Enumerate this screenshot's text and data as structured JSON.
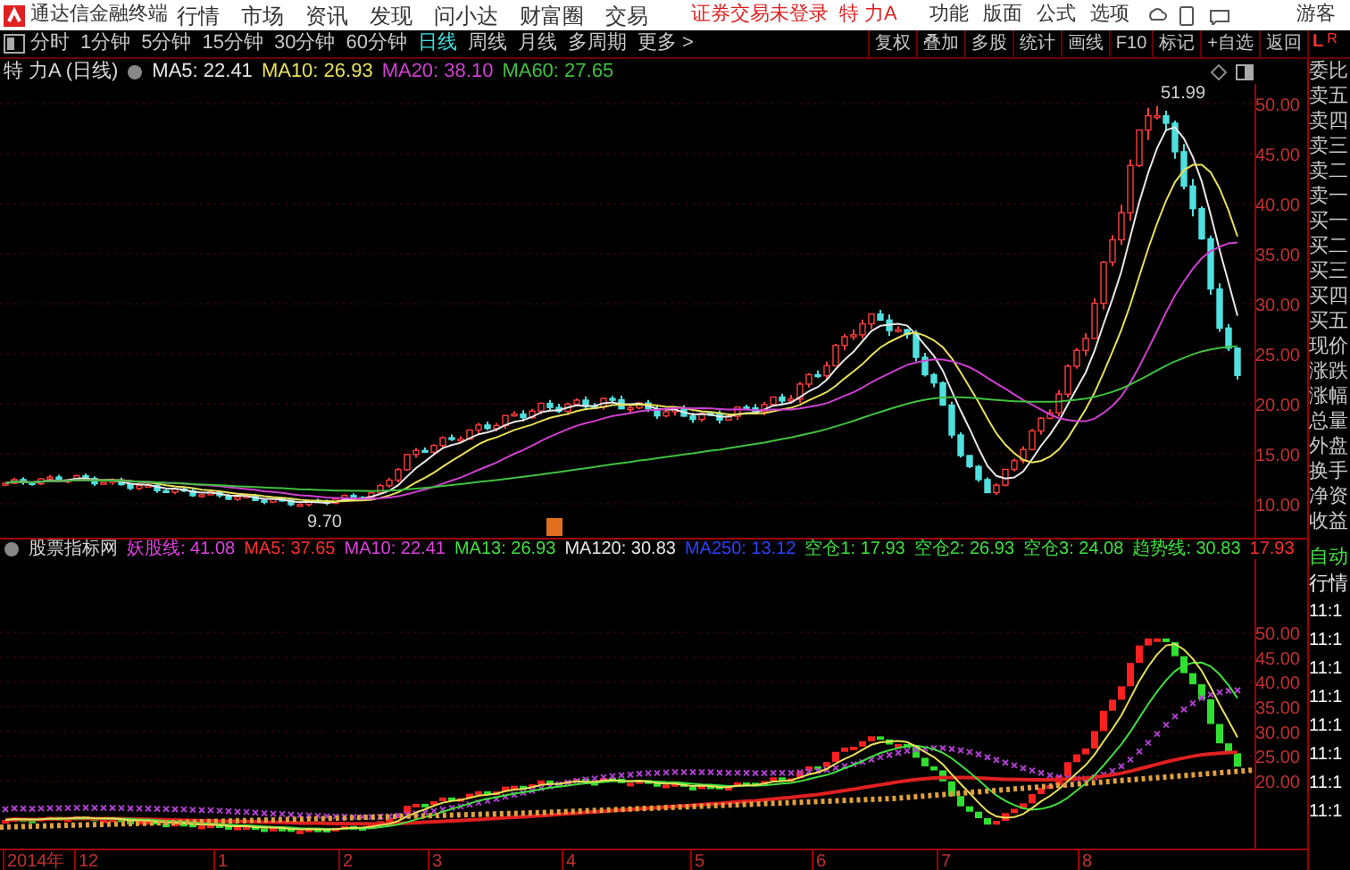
{
  "menu_bar": {
    "app_title": "通达信金融终端",
    "items": [
      "行情",
      "市场",
      "资讯",
      "发现",
      "问小达",
      "财富圈",
      "交易"
    ],
    "login_notice": "证券交易未登录",
    "stock_name": "特 力A",
    "right_items": [
      "功能",
      "版面",
      "公式",
      "选项"
    ],
    "user": "游客"
  },
  "period_tabs": [
    {
      "label": "分时",
      "selected": false
    },
    {
      "label": "1分钟",
      "selected": false
    },
    {
      "label": "5分钟",
      "selected": false
    },
    {
      "label": "15分钟",
      "selected": false
    },
    {
      "label": "30分钟",
      "selected": false
    },
    {
      "label": "60分钟",
      "selected": false
    },
    {
      "label": "日线",
      "selected": true
    },
    {
      "label": "周线",
      "selected": false
    },
    {
      "label": "月线",
      "selected": false
    },
    {
      "label": "多周期",
      "selected": false
    },
    {
      "label": "更多 >",
      "selected": false
    }
  ],
  "tool_buttons": [
    "复权",
    "叠加",
    "多股",
    "统计",
    "画线",
    "F10",
    "标记",
    "+自选",
    "返回"
  ],
  "panel_tabs": [
    "L",
    "R"
  ],
  "price_chart": {
    "title": "特 力A (日线)",
    "legend": [
      {
        "label": "MA5: 22.41",
        "color": "#e8e8e8"
      },
      {
        "label": "MA10: 26.93",
        "color": "#e8e05a"
      },
      {
        "label": "MA20: 38.10",
        "color": "#d040d0"
      },
      {
        "label": "MA60: 27.65",
        "color": "#40c040"
      }
    ],
    "y_ticks": [
      "50.00",
      "45.00",
      "40.00",
      "35.00",
      "30.00",
      "25.00",
      "20.00",
      "15.00",
      "10.00"
    ],
    "high_label": "51.99",
    "low_label": "9.70"
  },
  "indicator_chart": {
    "title": "股票指标网",
    "legend": [
      {
        "label": "妖股线: 41.08",
        "color": "#e040e0"
      },
      {
        "label": "MA5: 37.65",
        "color": "#ff3030"
      },
      {
        "label": "MA10: 22.41",
        "color": "#e040e0"
      },
      {
        "label": "MA13: 26.93",
        "color": "#40e040"
      },
      {
        "label": "MA120: 30.83",
        "color": "#e8e8e8"
      },
      {
        "label": "MA250: 13.12",
        "color": "#3040ff"
      },
      {
        "label": "空仓1: 17.93",
        "color": "#40e040"
      },
      {
        "label": "空仓2: 26.93",
        "color": "#40e040"
      },
      {
        "label": "空仓3: 24.08",
        "color": "#40e040"
      },
      {
        "label": "趋势线: 30.83",
        "color": "#40e040"
      },
      {
        "label": "17.93",
        "color": "#ff3030"
      }
    ],
    "y_ticks": [
      "50.00",
      "45.00",
      "40.00",
      "35.00",
      "30.00",
      "25.00",
      "20.00"
    ]
  },
  "x_axis": [
    "2014年",
    "12",
    "1",
    "2",
    "3",
    "4",
    "5",
    "6",
    "7",
    "8"
  ],
  "quote_panel": {
    "labels": [
      "委比",
      "卖五",
      "卖四",
      "卖三",
      "卖二",
      "卖一",
      "买一",
      "买二",
      "买三",
      "买四",
      "买五",
      "现价",
      "涨跌",
      "涨幅",
      "总量",
      "外盘",
      "换手",
      "净资",
      "收益"
    ],
    "mode": "自动",
    "section": "行情",
    "times": [
      "11:1",
      "11:1",
      "11:1",
      "11:1",
      "11:1",
      "11:1",
      "11:1",
      "11:1"
    ]
  }
}
